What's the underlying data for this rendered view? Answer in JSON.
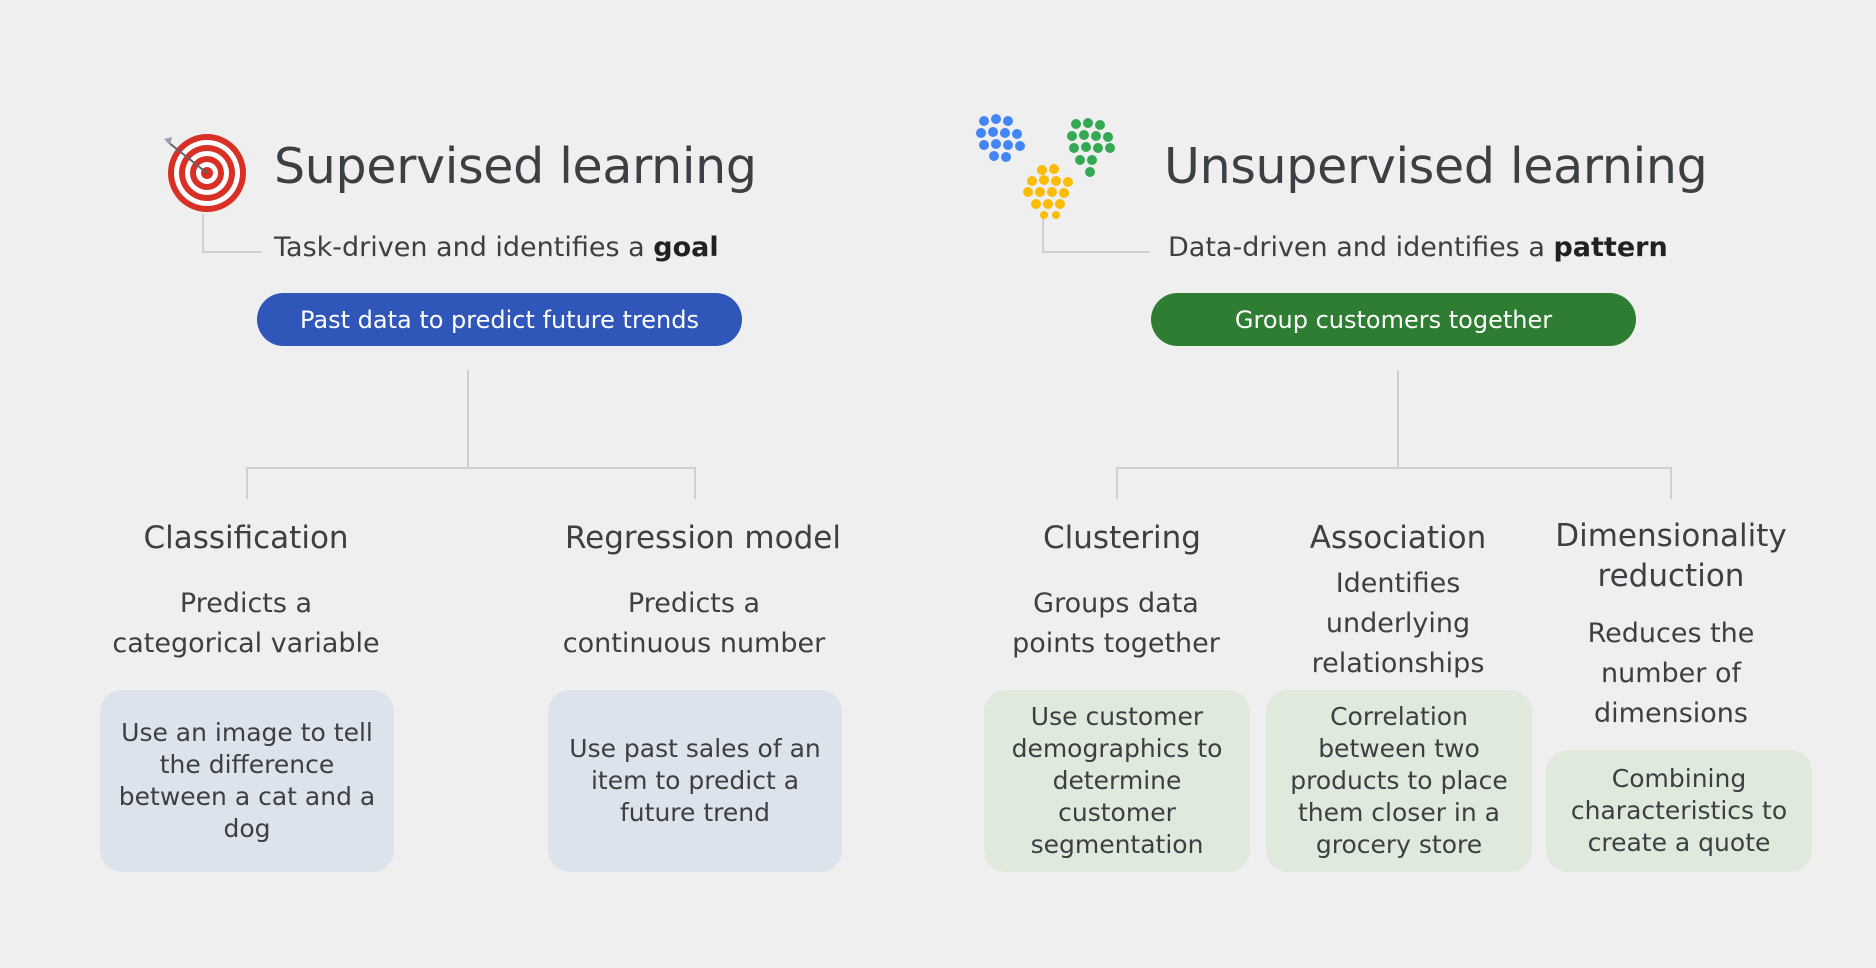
{
  "supervised": {
    "title": "Supervised learning",
    "subtitle_prefix": "Task-driven and identifies a ",
    "subtitle_emphasis": "goal",
    "pill": "Past data to predict future trends",
    "icon": "target-icon",
    "pill_color": "#2f56b8",
    "card_color": "#dde3ec",
    "columns": [
      {
        "title": "Classification",
        "description": "Predicts a categorical variable",
        "example": "Use an image to tell the difference between a cat and a dog"
      },
      {
        "title": "Regression model",
        "description": "Predicts a continuous number",
        "example": "Use past sales of an item to predict a future trend"
      }
    ]
  },
  "unsupervised": {
    "title": "Unsupervised learning",
    "subtitle_prefix": "Data-driven and identifies a ",
    "subtitle_emphasis": "pattern",
    "pill": "Group customers together",
    "icon": "clusters-icon",
    "pill_color": "#2e7d32",
    "card_color": "#dfe9dc",
    "columns": [
      {
        "title": "Clustering",
        "description": "Groups data points together",
        "example": "Use customer demographics to determine customer segmentation"
      },
      {
        "title": "Association",
        "description": "Identifies underlying relationships",
        "example": "Correlation between two products to place them closer in a grocery store"
      },
      {
        "title": "Dimensionality reduction",
        "description": "Reduces the number of dimensions",
        "example": "Combining characteristics to create a quote"
      }
    ]
  }
}
